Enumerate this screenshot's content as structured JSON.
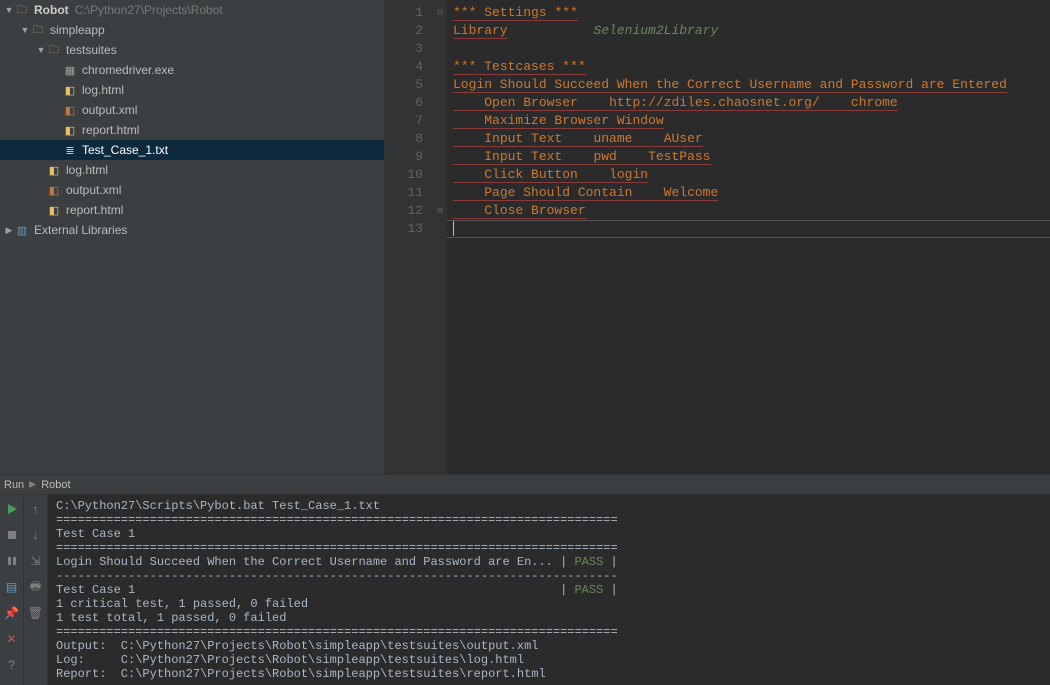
{
  "project": {
    "name": "Robot",
    "path": "C:\\Python27\\Projects\\Robot"
  },
  "tree": {
    "root": "Robot",
    "simpleapp": "simpleapp",
    "testsuites": "testsuites",
    "files_ts": {
      "chromedriver": "chromedriver.exe",
      "log": "log.html",
      "output": "output.xml",
      "report": "report.html",
      "tc1": "Test_Case_1.txt"
    },
    "files_sa": {
      "log": "log.html",
      "output": "output.xml",
      "report": "report.html"
    },
    "ext_lib": "External Libraries"
  },
  "code": {
    "l1": "*** Settings ***",
    "l2a": "Library",
    "l2b": "Selenium2Library",
    "l4": "*** Testcases ***",
    "l5": "Login Should Succeed When the Correct Username and Password are Entered",
    "l6a": "Open Browser",
    "l6b": "http://zdiles.chaosnet.org/",
    "l6c": "chrome",
    "l7a": "Maximize Browser Window",
    "l8a": "Input Text",
    "l8b": "uname",
    "l8c": "AUser",
    "l9a": "Input Text",
    "l9b": "pwd",
    "l9c": "TestPass",
    "l10a": "Click Button",
    "l10b": "login",
    "l11a": "Page Should Contain",
    "l11b": "Welcome",
    "l12a": "Close Browser"
  },
  "run": {
    "label": "Run",
    "config": "Robot"
  },
  "console_lines": [
    "C:\\Python27\\Scripts\\Pybot.bat Test_Case_1.txt",
    "==============================================================================",
    "Test Case 1",
    "==============================================================================",
    "Login Should Succeed When the Correct Username and Password are En... | PASS |",
    "------------------------------------------------------------------------------",
    "Test Case 1                                                           | PASS |",
    "1 critical test, 1 passed, 0 failed",
    "1 test total, 1 passed, 0 failed",
    "==============================================================================",
    "Output:  C:\\Python27\\Projects\\Robot\\simpleapp\\testsuites\\output.xml",
    "Log:     C:\\Python27\\Projects\\Robot\\simpleapp\\testsuites\\log.html",
    "Report:  C:\\Python27\\Projects\\Robot\\simpleapp\\testsuites\\report.html"
  ]
}
